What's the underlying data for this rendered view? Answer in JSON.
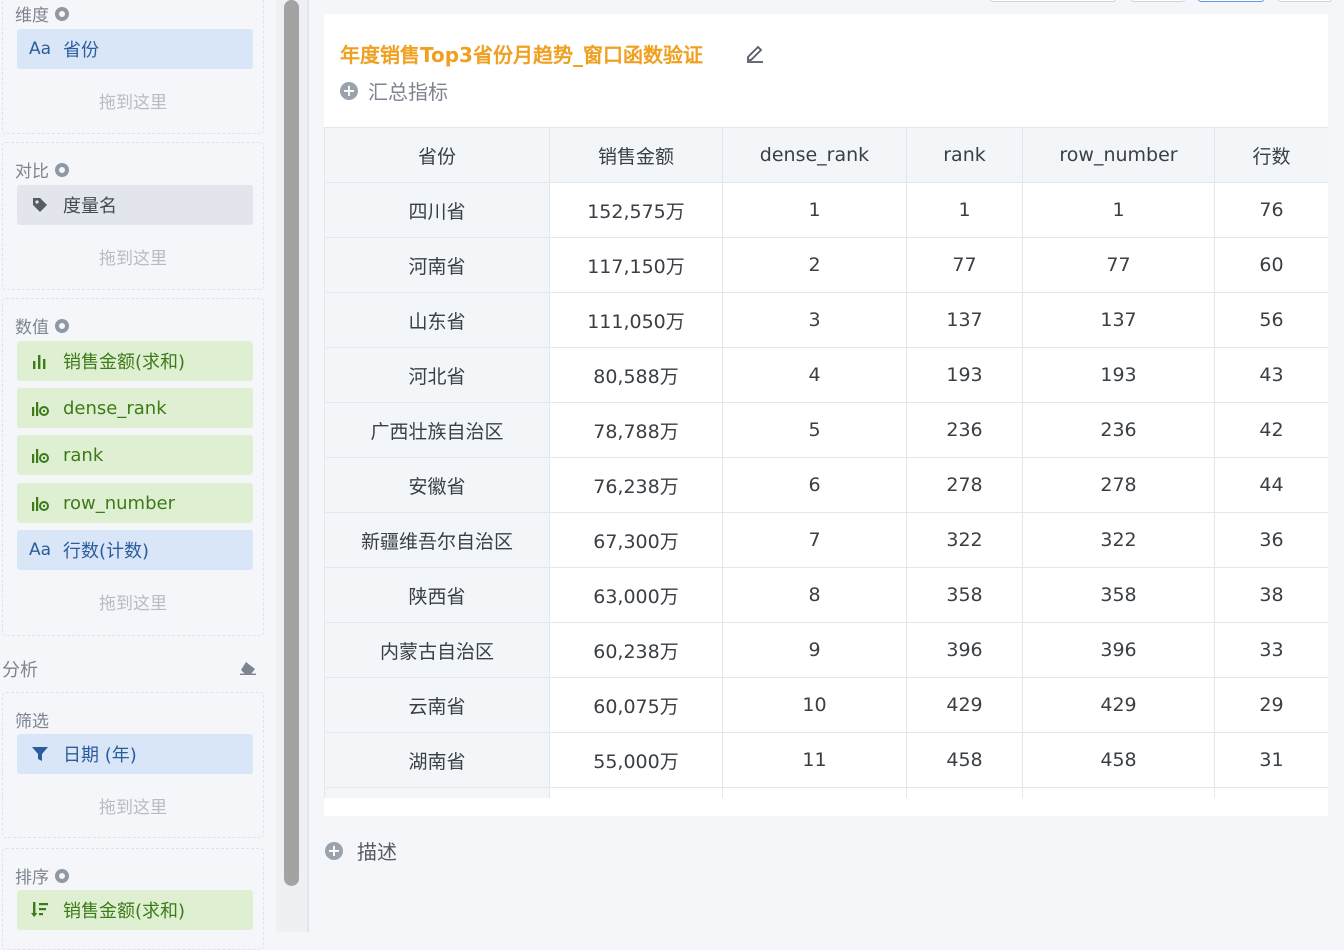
{
  "left_panel": {
    "dimension": {
      "title": "维度",
      "fields": [
        {
          "icon": "text-field-icon",
          "glyph": "Aa",
          "label": "省份"
        }
      ],
      "drop_hint": "拖到这里"
    },
    "compare": {
      "title": "对比",
      "fields": [
        {
          "icon": "tag-icon",
          "label": "度量名"
        }
      ],
      "drop_hint": "拖到这里"
    },
    "values": {
      "title": "数值",
      "fields": [
        {
          "icon": "bar-chart-icon",
          "label": "销售金额(求和)"
        },
        {
          "icon": "calc-measure-icon",
          "label": "dense_rank"
        },
        {
          "icon": "calc-measure-icon",
          "label": "rank"
        },
        {
          "icon": "calc-measure-icon",
          "label": "row_number"
        },
        {
          "icon": "text-field-icon",
          "glyph": "Aa",
          "label": "行数(计数)"
        }
      ],
      "drop_hint": "拖到这里"
    },
    "analysis": {
      "title": "分析"
    },
    "filter": {
      "title": "筛选",
      "fields": [
        {
          "icon": "filter-icon",
          "label": "日期 (年)"
        }
      ],
      "drop_hint": "拖到这里"
    },
    "sort": {
      "title": "排序",
      "fields": [
        {
          "icon": "sort-icon",
          "label": "销售金额(求和)"
        }
      ]
    }
  },
  "chart": {
    "title": "年度销售Top3省份月趋势_窗口函数验证",
    "summary_label": "汇总指标",
    "columns": [
      "省份",
      "销售金额",
      "dense_rank",
      "rank",
      "row_number",
      "行数"
    ],
    "rows": [
      [
        "四川省",
        "152,575万",
        "1",
        "1",
        "1",
        "76"
      ],
      [
        "河南省",
        "117,150万",
        "2",
        "77",
        "77",
        "60"
      ],
      [
        "山东省",
        "111,050万",
        "3",
        "137",
        "137",
        "56"
      ],
      [
        "河北省",
        "80,588万",
        "4",
        "193",
        "193",
        "43"
      ],
      [
        "广西壮族自治区",
        "78,788万",
        "5",
        "236",
        "236",
        "42"
      ],
      [
        "安徽省",
        "76,238万",
        "6",
        "278",
        "278",
        "44"
      ],
      [
        "新疆维吾尔自治区",
        "67,300万",
        "7",
        "322",
        "322",
        "36"
      ],
      [
        "陕西省",
        "63,000万",
        "8",
        "358",
        "358",
        "38"
      ],
      [
        "内蒙古自治区",
        "60,238万",
        "9",
        "396",
        "396",
        "33"
      ],
      [
        "云南省",
        "60,075万",
        "10",
        "429",
        "429",
        "29"
      ],
      [
        "湖南省",
        "55,000万",
        "11",
        "458",
        "458",
        "31"
      ]
    ],
    "description_label": "描述"
  },
  "colors": {
    "title": "#f0a020",
    "dimension_pill": "#d8e6f7",
    "measure_pill": "#dff0d2",
    "compare_pill": "#e2e6ec"
  }
}
